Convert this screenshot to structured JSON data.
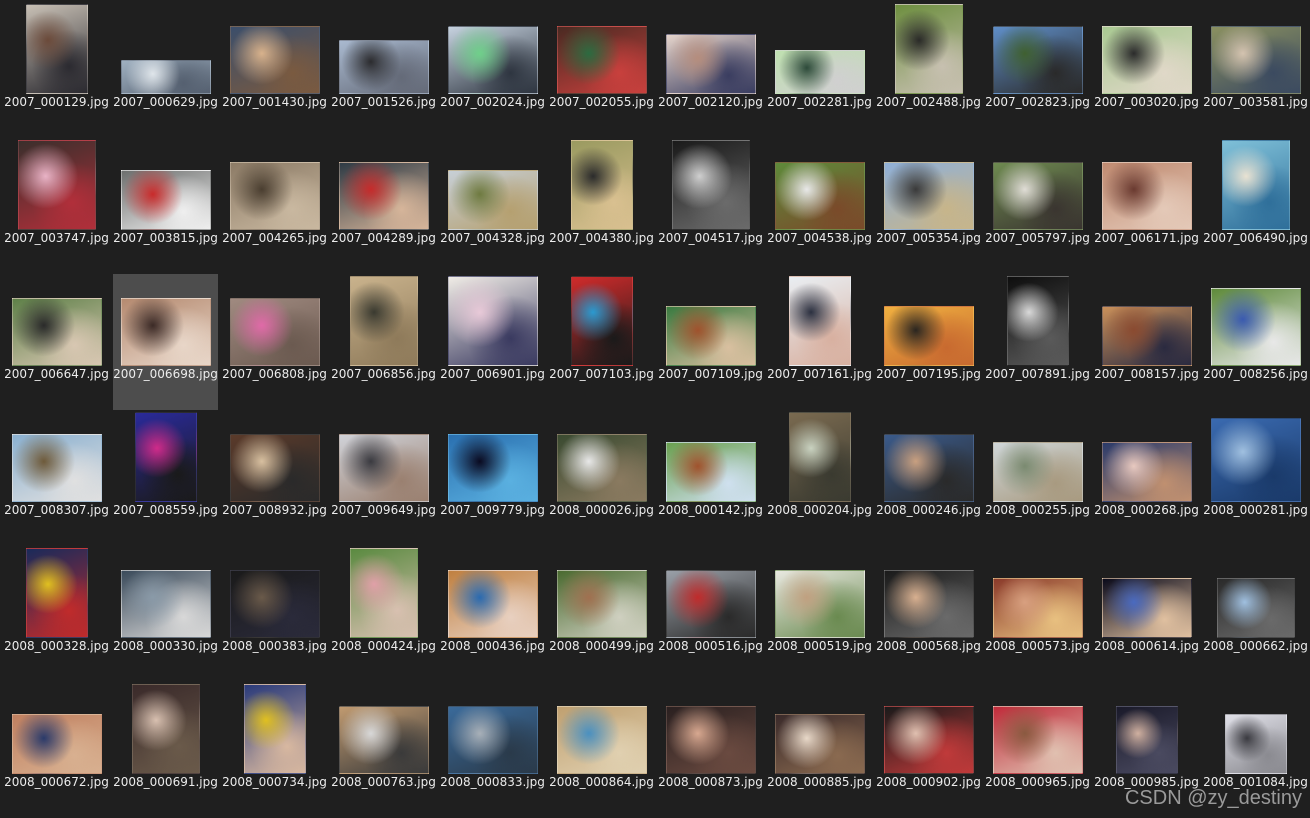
{
  "files": [
    {
      "name": "2007_000129.jpg",
      "thumb": {
        "w": 60,
        "h": 88,
        "colors": [
          "#c8c0b5",
          "#6b4a3a",
          "#2b2a30"
        ]
      }
    },
    {
      "name": "2007_000629.jpg",
      "thumb": {
        "w": 88,
        "h": 32,
        "colors": [
          "#9fb0c0",
          "#dfe5ea",
          "#556070"
        ]
      }
    },
    {
      "name": "2007_001430.jpg",
      "thumb": {
        "w": 88,
        "h": 66,
        "colors": [
          "#3b4e6a",
          "#d8b28c",
          "#7a5a40"
        ]
      }
    },
    {
      "name": "2007_001526.jpg",
      "thumb": {
        "w": 88,
        "h": 52,
        "colors": [
          "#a9b9cf",
          "#2b2b2e",
          "#646a78"
        ]
      }
    },
    {
      "name": "2007_002024.jpg",
      "thumb": {
        "w": 88,
        "h": 66,
        "colors": [
          "#c6d2df",
          "#6fd08a",
          "#2e3540"
        ]
      }
    },
    {
      "name": "2007_002055.jpg",
      "thumb": {
        "w": 88,
        "h": 66,
        "colors": [
          "#4a2a22",
          "#2c6b40",
          "#c8403d"
        ]
      }
    },
    {
      "name": "2007_002120.jpg",
      "thumb": {
        "w": 88,
        "h": 58,
        "colors": [
          "#e5d4cb",
          "#b58d7d",
          "#3a3d60"
        ]
      }
    },
    {
      "name": "2007_002281.jpg",
      "thumb": {
        "w": 88,
        "h": 42,
        "colors": [
          "#bfe0b0",
          "#2d4a3a",
          "#d0d0d0"
        ]
      }
    },
    {
      "name": "2007_002488.jpg",
      "thumb": {
        "w": 66,
        "h": 88,
        "colors": [
          "#6e8f40",
          "#2a2a28",
          "#c7c0b0"
        ]
      }
    },
    {
      "name": "2007_002823.jpg",
      "thumb": {
        "w": 88,
        "h": 66,
        "colors": [
          "#5f8ec8",
          "#3f6030",
          "#2a2a2a"
        ]
      }
    },
    {
      "name": "2007_003020.jpg",
      "thumb": {
        "w": 88,
        "h": 66,
        "colors": [
          "#a9c992",
          "#2b2b2b",
          "#e0d8c8"
        ]
      }
    },
    {
      "name": "2007_003581.jpg",
      "thumb": {
        "w": 88,
        "h": 66,
        "colors": [
          "#8a9060",
          "#d4c3b0",
          "#3b4a60"
        ]
      }
    },
    {
      "name": "2007_003747.jpg",
      "thumb": {
        "w": 76,
        "h": 88,
        "colors": [
          "#3a2f2c",
          "#e9b3c6",
          "#b12f3a"
        ]
      }
    },
    {
      "name": "2007_003815.jpg",
      "thumb": {
        "w": 88,
        "h": 58,
        "colors": [
          "#6d6f6e",
          "#c92b2b",
          "#efefef"
        ]
      }
    },
    {
      "name": "2007_004265.jpg",
      "thumb": {
        "w": 88,
        "h": 66,
        "colors": [
          "#8c7b66",
          "#4a3e30",
          "#c9b8a0"
        ]
      }
    },
    {
      "name": "2007_004289.jpg",
      "thumb": {
        "w": 88,
        "h": 66,
        "colors": [
          "#2f3b45",
          "#c62b2b",
          "#d6b59a"
        ]
      }
    },
    {
      "name": "2007_004328.jpg",
      "thumb": {
        "w": 88,
        "h": 58,
        "colors": [
          "#c7cfd6",
          "#6e7a40",
          "#b5a070"
        ]
      }
    },
    {
      "name": "2007_004380.jpg",
      "thumb": {
        "w": 60,
        "h": 88,
        "colors": [
          "#9a9a60",
          "#2b2b2b",
          "#d9c090"
        ]
      }
    },
    {
      "name": "2007_004517.jpg",
      "thumb": {
        "w": 76,
        "h": 88,
        "colors": [
          "#1a1a1a",
          "#cfcfcf",
          "#6b6b6b"
        ]
      }
    },
    {
      "name": "2007_004538.jpg",
      "thumb": {
        "w": 88,
        "h": 66,
        "colors": [
          "#5e8a3a",
          "#e8e8e8",
          "#7a4a2a"
        ]
      }
    },
    {
      "name": "2007_005354.jpg",
      "thumb": {
        "w": 88,
        "h": 66,
        "colors": [
          "#8fb0d8",
          "#3a3a3a",
          "#c7b58a"
        ]
      }
    },
    {
      "name": "2007_005797.jpg",
      "thumb": {
        "w": 88,
        "h": 66,
        "colors": [
          "#6e8a50",
          "#e0ddd6",
          "#3a3530"
        ]
      }
    },
    {
      "name": "2007_006171.jpg",
      "thumb": {
        "w": 88,
        "h": 66,
        "colors": [
          "#c08a70",
          "#6a3a30",
          "#e4c9b8"
        ]
      }
    },
    {
      "name": "2007_006490.jpg",
      "thumb": {
        "w": 66,
        "h": 88,
        "colors": [
          "#7fc0d8",
          "#e9e2d2",
          "#2f6f9a"
        ]
      }
    },
    {
      "name": "2007_006647.jpg",
      "thumb": {
        "w": 88,
        "h": 66,
        "colors": [
          "#5e8048",
          "#2a2a2a",
          "#d8c7b2"
        ]
      }
    },
    {
      "name": "2007_006698.jpg",
      "thumb": {
        "w": 88,
        "h": 66,
        "colors": [
          "#b58a70",
          "#3b2a26",
          "#e8d6c8"
        ]
      },
      "selected": true
    },
    {
      "name": "2007_006808.jpg",
      "thumb": {
        "w": 88,
        "h": 66,
        "colors": [
          "#a08a80",
          "#e06aa8",
          "#6b5a50"
        ]
      }
    },
    {
      "name": "2007_006856.jpg",
      "thumb": {
        "w": 66,
        "h": 88,
        "colors": [
          "#c9b28c",
          "#3a3a30",
          "#8e7a5a"
        ]
      }
    },
    {
      "name": "2007_006901.jpg",
      "thumb": {
        "w": 88,
        "h": 88,
        "colors": [
          "#f0ece6",
          "#e8c9d8",
          "#3a3a60"
        ]
      }
    },
    {
      "name": "2007_007103.jpg",
      "thumb": {
        "w": 60,
        "h": 88,
        "colors": [
          "#d02b2b",
          "#2a9ad0",
          "#1a1a1a"
        ]
      }
    },
    {
      "name": "2007_007109.jpg",
      "thumb": {
        "w": 88,
        "h": 58,
        "colors": [
          "#3a7a40",
          "#a0522d",
          "#d9c0a0"
        ]
      }
    },
    {
      "name": "2007_007161.jpg",
      "thumb": {
        "w": 60,
        "h": 88,
        "colors": [
          "#e9eef2",
          "#2b3040",
          "#d8b0a0"
        ]
      }
    },
    {
      "name": "2007_007195.jpg",
      "thumb": {
        "w": 88,
        "h": 58,
        "colors": [
          "#f0b040",
          "#2a2520",
          "#c86a30"
        ]
      }
    },
    {
      "name": "2007_007891.jpg",
      "thumb": {
        "w": 60,
        "h": 88,
        "colors": [
          "#0e0e0e",
          "#d9d9d9",
          "#5a5a5a"
        ]
      }
    },
    {
      "name": "2007_008157.jpg",
      "thumb": {
        "w": 88,
        "h": 58,
        "colors": [
          "#c9905a",
          "#8a4a30",
          "#2a2a40"
        ]
      }
    },
    {
      "name": "2007_008256.jpg",
      "thumb": {
        "w": 88,
        "h": 76,
        "colors": [
          "#5e8a3a",
          "#3a5ab0",
          "#e8e8e8"
        ]
      }
    },
    {
      "name": "2007_008307.jpg",
      "thumb": {
        "w": 88,
        "h": 66,
        "colors": [
          "#8ab0d0",
          "#6e5a3a",
          "#e0e0e0"
        ]
      }
    },
    {
      "name": "2007_008559.jpg",
      "thumb": {
        "w": 60,
        "h": 88,
        "colors": [
          "#2a2a9a",
          "#d02b8a",
          "#1a1a1a"
        ]
      }
    },
    {
      "name": "2007_008932.jpg",
      "thumb": {
        "w": 88,
        "h": 66,
        "colors": [
          "#5a3a2a",
          "#d8c0a0",
          "#2a2a2a"
        ]
      }
    },
    {
      "name": "2007_009649.jpg",
      "thumb": {
        "w": 88,
        "h": 66,
        "colors": [
          "#d0d2d8",
          "#3a3a40",
          "#9a8070"
        ]
      }
    },
    {
      "name": "2007_009779.jpg",
      "thumb": {
        "w": 88,
        "h": 66,
        "colors": [
          "#2a70b0",
          "#0a0a20",
          "#5ab0e0"
        ]
      }
    },
    {
      "name": "2008_000026.jpg",
      "thumb": {
        "w": 88,
        "h": 66,
        "colors": [
          "#3a4a30",
          "#e8e8e8",
          "#8a7a60"
        ]
      }
    },
    {
      "name": "2008_000142.jpg",
      "thumb": {
        "w": 88,
        "h": 58,
        "colors": [
          "#6aa050",
          "#a0522d",
          "#cfe0ef"
        ]
      }
    },
    {
      "name": "2008_000204.jpg",
      "thumb": {
        "w": 60,
        "h": 88,
        "colors": [
          "#7a6a50",
          "#c9d2c0",
          "#3a3a30"
        ]
      }
    },
    {
      "name": "2008_000246.jpg",
      "thumb": {
        "w": 88,
        "h": 66,
        "colors": [
          "#3a5a8a",
          "#c9a080",
          "#2a2a2a"
        ]
      }
    },
    {
      "name": "2008_000255.jpg",
      "thumb": {
        "w": 88,
        "h": 58,
        "colors": [
          "#cfd6d8",
          "#7a8a70",
          "#a89a80"
        ]
      }
    },
    {
      "name": "2008_000268.jpg",
      "thumb": {
        "w": 88,
        "h": 58,
        "colors": [
          "#2a3a6a",
          "#e8c9c0",
          "#c09070"
        ]
      }
    },
    {
      "name": "2008_000281.jpg",
      "thumb": {
        "w": 88,
        "h": 82,
        "colors": [
          "#3a6ab0",
          "#a0c0e0",
          "#1a3a6a"
        ]
      }
    },
    {
      "name": "2008_000328.jpg",
      "thumb": {
        "w": 60,
        "h": 88,
        "colors": [
          "#1a2a5a",
          "#e0c020",
          "#c02b2b"
        ]
      }
    },
    {
      "name": "2008_000330.jpg",
      "thumb": {
        "w": 88,
        "h": 66,
        "colors": [
          "#3a4a5a",
          "#8a9aa8",
          "#d8d8d8"
        ]
      }
    },
    {
      "name": "2008_000383.jpg",
      "thumb": {
        "w": 88,
        "h": 66,
        "colors": [
          "#1a1a1a",
          "#6a5a4a",
          "#2a2a3a"
        ]
      }
    },
    {
      "name": "2008_000424.jpg",
      "thumb": {
        "w": 66,
        "h": 88,
        "colors": [
          "#5a8a40",
          "#e0a0a8",
          "#d8c0b0"
        ]
      }
    },
    {
      "name": "2008_000436.jpg",
      "thumb": {
        "w": 88,
        "h": 66,
        "colors": [
          "#c08040",
          "#2a6ab0",
          "#e8d0c0"
        ]
      }
    },
    {
      "name": "2008_000499.jpg",
      "thumb": {
        "w": 88,
        "h": 66,
        "colors": [
          "#4a6a30",
          "#a07050",
          "#cfd0c0"
        ]
      }
    },
    {
      "name": "2008_000516.jpg",
      "thumb": {
        "w": 88,
        "h": 66,
        "colors": [
          "#9aa0a8",
          "#c02b2b",
          "#2a2a2a"
        ]
      }
    },
    {
      "name": "2008_000519.jpg",
      "thumb": {
        "w": 88,
        "h": 66,
        "colors": [
          "#e8e8e0",
          "#c0a080",
          "#6a8a50"
        ]
      }
    },
    {
      "name": "2008_000568.jpg",
      "thumb": {
        "w": 88,
        "h": 66,
        "colors": [
          "#1a1a1a",
          "#d8b090",
          "#6a6a6a"
        ]
      }
    },
    {
      "name": "2008_000573.jpg",
      "thumb": {
        "w": 88,
        "h": 58,
        "colors": [
          "#8a3a2a",
          "#d8a080",
          "#e8c080"
        ]
      }
    },
    {
      "name": "2008_000614.jpg",
      "thumb": {
        "w": 88,
        "h": 58,
        "colors": [
          "#0a0a1a",
          "#4a6ac0",
          "#e0c0a0"
        ]
      }
    },
    {
      "name": "2008_000662.jpg",
      "thumb": {
        "w": 76,
        "h": 58,
        "colors": [
          "#2a2a2a",
          "#a0c0e0",
          "#6a6a6a"
        ]
      }
    },
    {
      "name": "2008_000672.jpg",
      "thumb": {
        "w": 88,
        "h": 58,
        "colors": [
          "#c08060",
          "#2a3a6a",
          "#d8b090"
        ]
      }
    },
    {
      "name": "2008_000691.jpg",
      "thumb": {
        "w": 66,
        "h": 88,
        "colors": [
          "#3a2a2a",
          "#d8c0b0",
          "#6a5a4a"
        ]
      }
    },
    {
      "name": "2008_000734.jpg",
      "thumb": {
        "w": 60,
        "h": 88,
        "colors": [
          "#2a3a7a",
          "#e0c020",
          "#d8b8a0"
        ]
      }
    },
    {
      "name": "2008_000763.jpg",
      "thumb": {
        "w": 88,
        "h": 66,
        "colors": [
          "#c09a70",
          "#d8d8d8",
          "#3a3a3a"
        ]
      }
    },
    {
      "name": "2008_000833.jpg",
      "thumb": {
        "w": 88,
        "h": 66,
        "colors": [
          "#3a6a9a",
          "#a8b0b8",
          "#2a3a4a"
        ]
      }
    },
    {
      "name": "2008_000864.jpg",
      "thumb": {
        "w": 88,
        "h": 66,
        "colors": [
          "#c0a070",
          "#4a90c0",
          "#e0d0b0"
        ]
      }
    },
    {
      "name": "2008_000873.jpg",
      "thumb": {
        "w": 88,
        "h": 66,
        "colors": [
          "#2a2020",
          "#d8a890",
          "#6a4a40"
        ]
      }
    },
    {
      "name": "2008_000885.jpg",
      "thumb": {
        "w": 88,
        "h": 58,
        "colors": [
          "#3a2a2a",
          "#e8d8c8",
          "#8a6a50"
        ]
      }
    },
    {
      "name": "2008_000902.jpg",
      "thumb": {
        "w": 88,
        "h": 66,
        "colors": [
          "#1a1a1a",
          "#e0c0b0",
          "#c03a3a"
        ]
      }
    },
    {
      "name": "2008_000965.jpg",
      "thumb": {
        "w": 88,
        "h": 66,
        "colors": [
          "#c02b3a",
          "#8a5a40",
          "#e0c0b0"
        ]
      }
    },
    {
      "name": "2008_000985.jpg",
      "thumb": {
        "w": 60,
        "h": 66,
        "colors": [
          "#1a1a2a",
          "#d0b0a0",
          "#4a4a60"
        ]
      }
    },
    {
      "name": "2008_001084.jpg",
      "thumb": {
        "w": 60,
        "h": 58,
        "colors": [
          "#e0e0e8",
          "#3a3a40",
          "#8a8a90"
        ]
      }
    }
  ],
  "watermark": "CSDN @zy_destiny"
}
